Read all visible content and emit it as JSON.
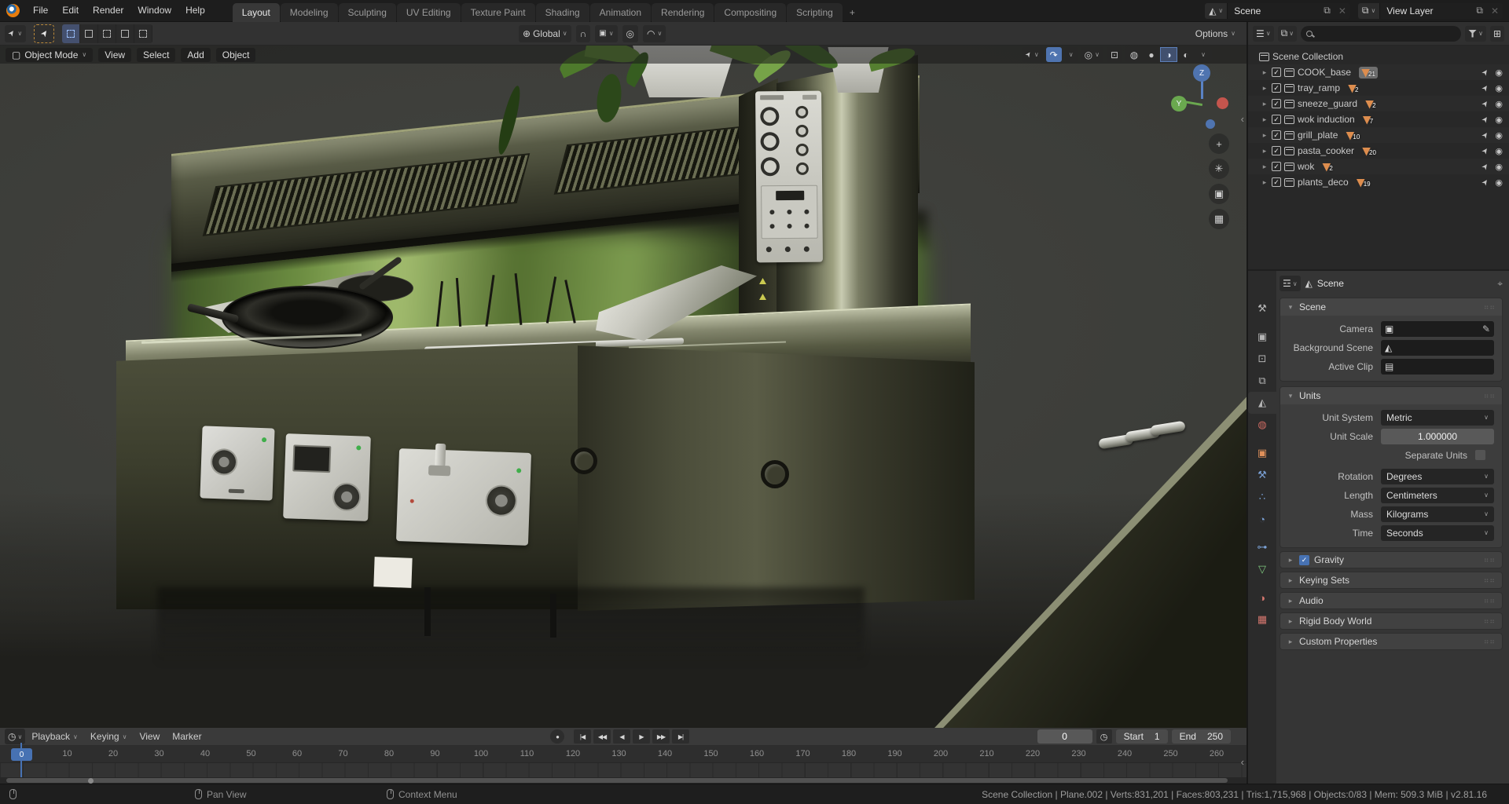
{
  "topbar": {
    "menus": [
      "File",
      "Edit",
      "Render",
      "Window",
      "Help"
    ],
    "workspaces": [
      "Layout",
      "Modeling",
      "Sculpting",
      "UV Editing",
      "Texture Paint",
      "Shading",
      "Animation",
      "Rendering",
      "Compositing",
      "Scripting"
    ],
    "add_workspace": "+",
    "scene_name": "Scene",
    "view_layer_name": "View Layer"
  },
  "tool_settings": {
    "orientation": "Global",
    "options": "Options"
  },
  "viewport": {
    "mode": "Object Mode",
    "menus": [
      "View",
      "Select",
      "Add",
      "Object"
    ],
    "axis_z": "Z",
    "axis_y": "Y"
  },
  "outliner": {
    "root": "Scene Collection",
    "collections": [
      {
        "name": "COOK_base",
        "count": "21"
      },
      {
        "name": "tray_ramp",
        "count": "2"
      },
      {
        "name": "sneeze_guard",
        "count": "2"
      },
      {
        "name": "wok induction",
        "count": "7"
      },
      {
        "name": "grill_plate",
        "count": "10"
      },
      {
        "name": "pasta_cooker",
        "count": "20"
      },
      {
        "name": "wok",
        "count": "2"
      },
      {
        "name": "plants_deco",
        "count": "19"
      }
    ]
  },
  "properties": {
    "breadcrumb": "Scene",
    "scene_panel": {
      "title": "Scene",
      "camera_label": "Camera",
      "background_label": "Background Scene",
      "clip_label": "Active Clip"
    },
    "units_panel": {
      "title": "Units",
      "unit_system_label": "Unit System",
      "unit_system": "Metric",
      "unit_scale_label": "Unit Scale",
      "unit_scale": "1.000000",
      "separate_label": "Separate Units",
      "rotation_label": "Rotation",
      "rotation": "Degrees",
      "length_label": "Length",
      "length": "Centimeters",
      "mass_label": "Mass",
      "mass": "Kilograms",
      "time_label": "Time",
      "time": "Seconds"
    },
    "collapsed": [
      "Gravity",
      "Keying Sets",
      "Audio",
      "Rigid Body World",
      "Custom Properties"
    ]
  },
  "timeline": {
    "menus": [
      "Playback",
      "Keying",
      "View",
      "Marker"
    ],
    "current_frame": "0",
    "start_label": "Start",
    "start_value": "1",
    "end_label": "End",
    "end_value": "250",
    "ticks": [
      "0",
      "10",
      "20",
      "30",
      "40",
      "50",
      "60",
      "70",
      "80",
      "90",
      "100",
      "110",
      "120",
      "130",
      "140",
      "150",
      "160",
      "170",
      "180",
      "190",
      "200",
      "210",
      "220",
      "230",
      "240",
      "250",
      "260"
    ]
  },
  "status_bar": {
    "hint_pan": "Pan View",
    "hint_context": "Context Menu",
    "info": "Scene Collection | Plane.002 | Verts:831,201 | Faces:803,231 | Tris:1,715,968 | Objects:0/83 | Mem: 509.3 MiB | v2.81.16"
  },
  "colors": {
    "accent": "#4772b3",
    "blender_orange": "#e87d0d",
    "mesh_badge": "#dd8d4e",
    "axis_x": "#c4554d",
    "axis_y": "#6aa84f",
    "axis_z": "#4f74b0"
  },
  "icons": {
    "chevron": "∨",
    "disclosure": "▸",
    "disclosure_open": "▾",
    "close": "✕",
    "copy": "⧉",
    "check": "✓",
    "pointer": "➤",
    "eye_target": "◉",
    "mesh": "▽",
    "magnet": "∩",
    "proportional": "◎",
    "orientation": "⊕",
    "falloff": "◠",
    "record": "●",
    "jump_start": "|◀",
    "prev_key": "◀◀",
    "play_back": "◀",
    "play": "▶",
    "next_key": "▶▶",
    "jump_end": "▶|",
    "clock": "◷",
    "pin": "⌖",
    "drag": "⠶⠶",
    "new_collection": "⊞",
    "zoom_plus": "+",
    "hand": "✳",
    "camera_view": "▣",
    "grid_ortho": "▦",
    "collapse": "‹",
    "gizmo_arc": "↷",
    "overlays": "◎",
    "xray": "⊡",
    "shade_wire": "◍",
    "shade_solid": "●",
    "shade_material": "◑",
    "shade_render": "◐",
    "editor_props": "☲",
    "editor_outliner": "☰",
    "view_layer_icon": "⧉",
    "scene_icon": "◭",
    "mode_icon": "▢",
    "cursor_tool": "➤",
    "tab_tool": "⚒",
    "tab_render": "▣",
    "tab_output": "⊡",
    "tab_view_layer": "⧉",
    "tab_scene": "◭",
    "tab_world": "◍",
    "tab_object": "▣",
    "tab_modifiers": "⚒",
    "tab_particles": "∴",
    "tab_physics": "◔",
    "tab_constraints": "⊶",
    "tab_data": "▽",
    "tab_material": "◑",
    "tab_texture": "▦",
    "camera_field": "▣",
    "clip_field": "▤",
    "eyedropper": "✎"
  }
}
